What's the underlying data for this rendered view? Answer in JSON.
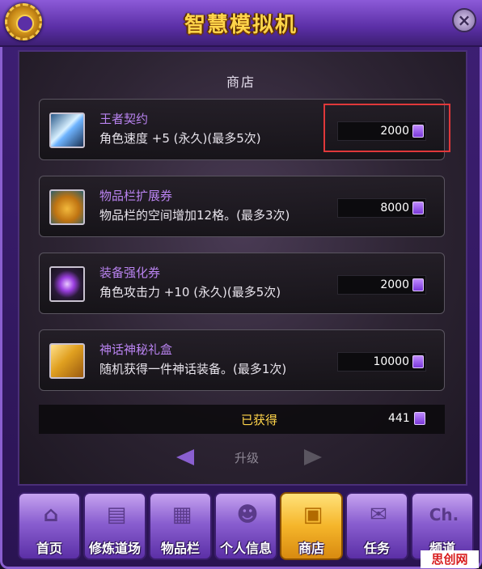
{
  "window": {
    "title": "智慧模拟机",
    "close_symbol": "×"
  },
  "shop": {
    "header": "商店"
  },
  "items": [
    {
      "name": "王者契约",
      "description": "角色速度 +5 (永久)(最多5次)",
      "price": "2000",
      "icon": "sword-icon"
    },
    {
      "name": "物品栏扩展券",
      "description": "物品栏的空间增加12格。(最多3次)",
      "price": "8000",
      "icon": "bag-icon"
    },
    {
      "name": "装备强化券",
      "description": "角色攻击力 +10 (永久)(最多5次)",
      "price": "2000",
      "icon": "gem-icon"
    },
    {
      "name": "神话神秘礼盒",
      "description": "随机获得一件神话装备。(最多1次)",
      "price": "10000",
      "icon": "gift-box-icon"
    }
  ],
  "obtained": {
    "label": "已获得",
    "value": "441"
  },
  "upgrade": {
    "label": "升级"
  },
  "nav": [
    {
      "label": "首页",
      "icon": "home-icon",
      "glyph": "⌂"
    },
    {
      "label": "修炼道场",
      "icon": "book-icon",
      "glyph": "▤"
    },
    {
      "label": "物品栏",
      "icon": "inventory-icon",
      "glyph": "▦"
    },
    {
      "label": "个人信息",
      "icon": "person-icon",
      "glyph": "☻"
    },
    {
      "label": "商店",
      "icon": "shop-box-icon",
      "glyph": "▣"
    },
    {
      "label": "任务",
      "icon": "scroll-icon",
      "glyph": "✉"
    },
    {
      "label": "频道",
      "icon": "channel-icon",
      "glyph": "Ch."
    }
  ],
  "watermark": "思创网",
  "colors": {
    "accent": "#8a5fd0",
    "title": "#ffd44a",
    "item_name": "#b983f0",
    "highlight": "#e0383a"
  }
}
